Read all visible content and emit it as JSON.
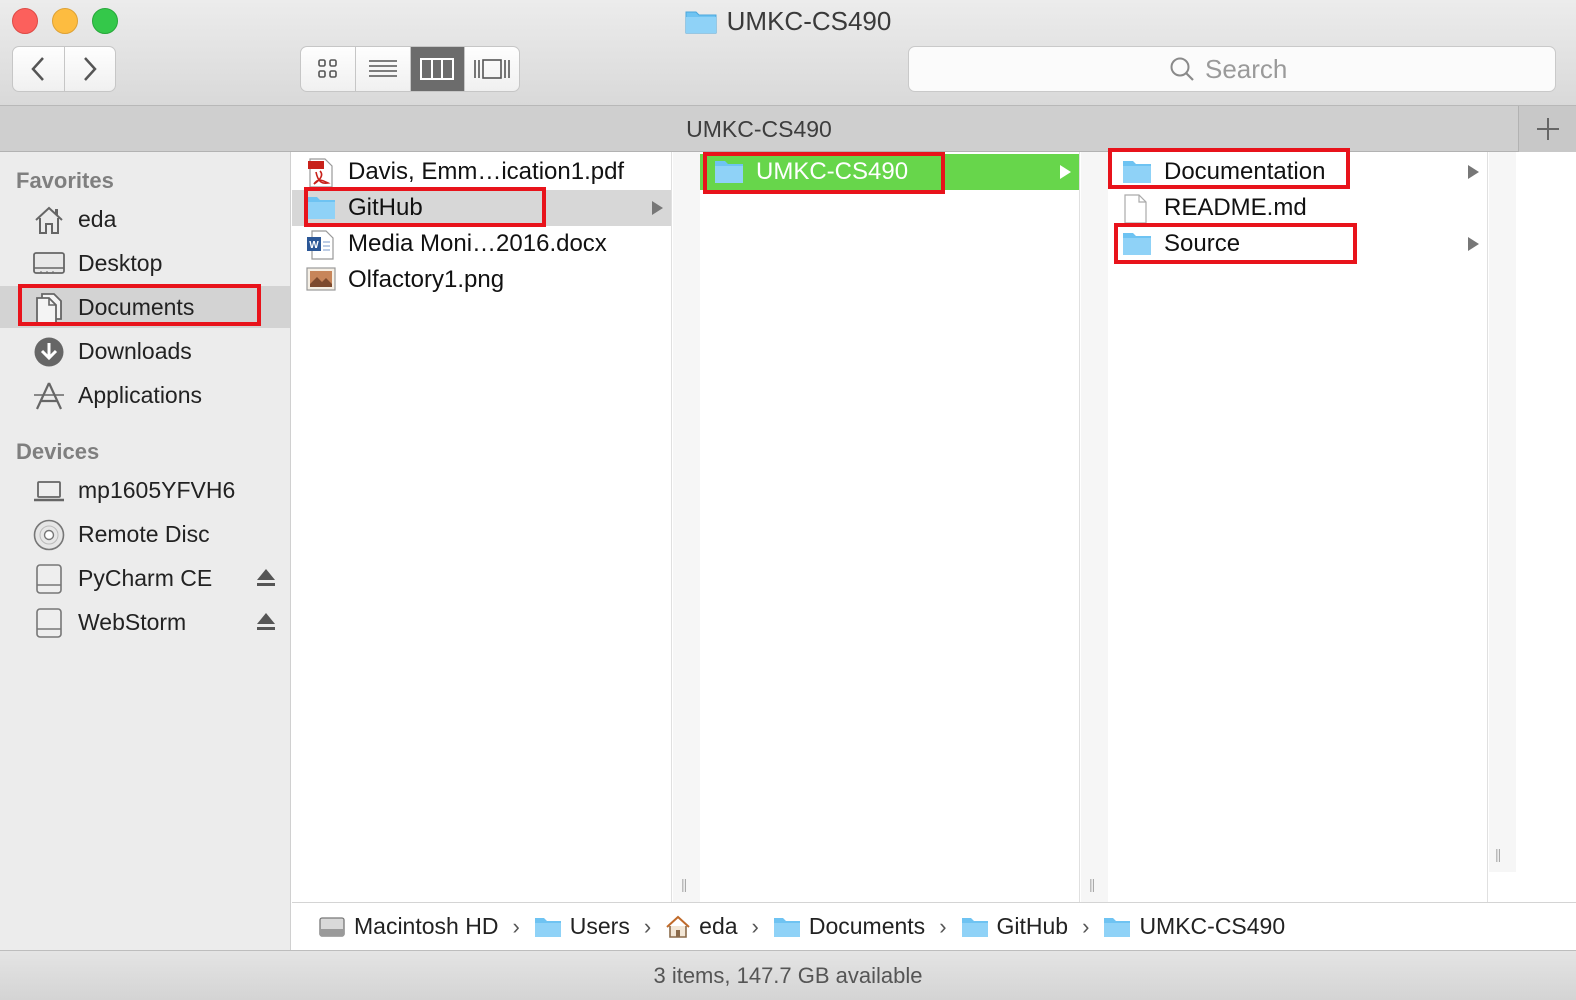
{
  "window": {
    "title": "UMKC-CS490"
  },
  "toolbar": {
    "search_placeholder": "Search"
  },
  "tab": {
    "title": "UMKC-CS490"
  },
  "sidebar": {
    "favorites_header": "Favorites",
    "favorites": [
      {
        "label": "eda",
        "icon": "home-icon"
      },
      {
        "label": "Desktop",
        "icon": "desktop-icon"
      },
      {
        "label": "Documents",
        "icon": "documents-icon",
        "selected": true
      },
      {
        "label": "Downloads",
        "icon": "downloads-icon"
      },
      {
        "label": "Applications",
        "icon": "applications-icon"
      }
    ],
    "devices_header": "Devices",
    "devices": [
      {
        "label": "mp1605YFVH6",
        "icon": "laptop-icon"
      },
      {
        "label": "Remote Disc",
        "icon": "disc-icon"
      },
      {
        "label": "PyCharm CE",
        "icon": "drive-icon",
        "eject": true
      },
      {
        "label": "WebStorm",
        "icon": "drive-icon",
        "eject": true
      }
    ]
  },
  "columns": [
    {
      "items": [
        {
          "name": "Davis, Emm…ication1.pdf",
          "icon": "pdf-icon"
        },
        {
          "name": "GitHub",
          "icon": "folder-icon",
          "selected": true,
          "has_children": true
        },
        {
          "name": "Media Moni…2016.docx",
          "icon": "word-doc-icon"
        },
        {
          "name": "Olfactory1.png",
          "icon": "image-icon"
        }
      ]
    },
    {
      "items": [
        {
          "name": "UMKC-CS490",
          "icon": "folder-icon",
          "selected": true,
          "has_children": true
        }
      ]
    },
    {
      "items": [
        {
          "name": "Documentation",
          "icon": "folder-icon",
          "has_children": true
        },
        {
          "name": "README.md",
          "icon": "file-icon"
        },
        {
          "name": "Source",
          "icon": "folder-icon",
          "has_children": true
        }
      ]
    }
  ],
  "path_bar": [
    {
      "label": "Macintosh HD",
      "icon": "hard-drive-icon"
    },
    {
      "label": "Users",
      "icon": "folder-icon"
    },
    {
      "label": "eda",
      "icon": "home-icon"
    },
    {
      "label": "Documents",
      "icon": "folder-icon"
    },
    {
      "label": "GitHub",
      "icon": "folder-icon"
    },
    {
      "label": "UMKC-CS490",
      "icon": "folder-icon"
    }
  ],
  "status": {
    "text": "3 items, 147.7 GB available"
  },
  "colors": {
    "selection_green": "#67d64b",
    "highlight_red": "#e8131b",
    "folder_blue": "#6ec3f2"
  }
}
